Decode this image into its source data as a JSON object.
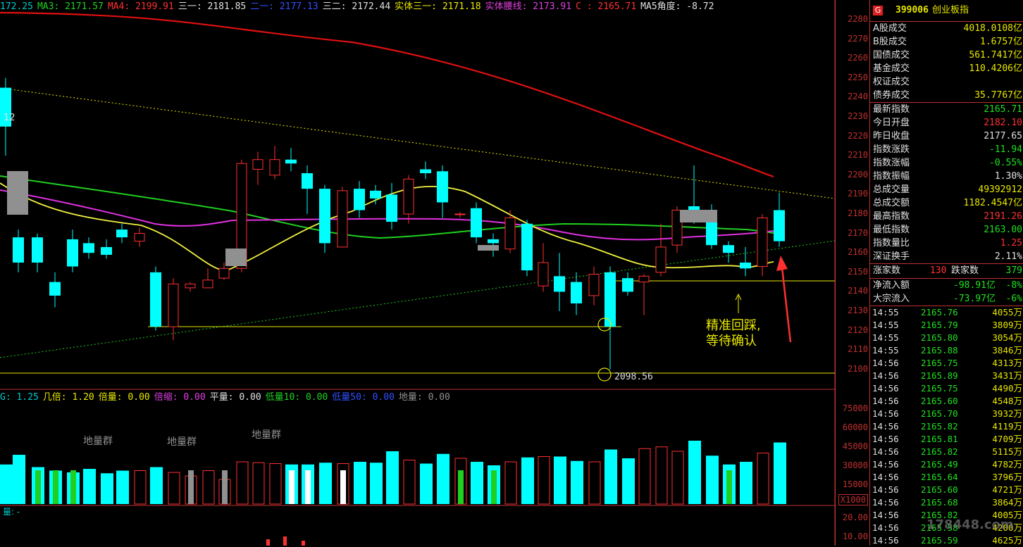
{
  "ma_bar": [
    {
      "text": "172.25",
      "color": "#00c8c8"
    },
    {
      "text": "MA3: 2171.57",
      "color": "#20d020"
    },
    {
      "text": "MA4: 2199.91",
      "color": "#ff3030"
    },
    {
      "text": "三一: 2181.85",
      "color": "#e0e0e0"
    },
    {
      "text": "二一: 2177.13",
      "color": "#3050ff"
    },
    {
      "text": "三二: 2172.44",
      "color": "#e0e0e0"
    },
    {
      "text": "实体三一: 2171.18",
      "color": "#e8e800"
    },
    {
      "text": "实体腰线: 2173.91",
      "color": "#e040e0"
    },
    {
      "text": "C : 2165.71",
      "color": "#ff3030"
    },
    {
      "text": "MA5角度: -8.72",
      "color": "#e0e0e0"
    }
  ],
  "vol_bar": [
    {
      "text": "G: 1.25",
      "color": "#00c8c8"
    },
    {
      "text": "几倍: 1.20",
      "color": "#e8e800"
    },
    {
      "text": "倍量: 0.00",
      "color": "#e8e800"
    },
    {
      "text": "倍缩: 0.00",
      "color": "#e040e0"
    },
    {
      "text": "平量: 0.00",
      "color": "#e0e0e0"
    },
    {
      "text": "低量10: 0.00",
      "color": "#20d020"
    },
    {
      "text": "低量50: 0.00",
      "color": "#3050ff"
    },
    {
      "text": "地量: 0.00",
      "color": "#909090"
    }
  ],
  "price_axis": [
    "2280",
    "2270",
    "2260",
    "2250",
    "2240",
    "2230",
    "2220",
    "2210",
    "2200",
    "2190",
    "2180",
    "2170",
    "2160",
    "2150",
    "2140",
    "2130",
    "2120",
    "2110",
    "2100"
  ],
  "vol_axis": [
    "75000",
    "60000",
    "45000",
    "30000",
    "15000",
    "X1000"
  ],
  "low_axis": [
    "20.00",
    "10.00"
  ],
  "labels": {
    "low_point": "2098.56",
    "left_num": "12",
    "ground_vol_1": "地量群",
    "ground_vol_2": "地量群",
    "ground_vol_3": "地量群",
    "note_line1": "精准回踩,",
    "note_line2": "等待确认",
    "watermark": "178448.com"
  },
  "header": {
    "badge": "G",
    "code": "399006",
    "name": "创业板指"
  },
  "stats_a": [
    {
      "label": "A股成交",
      "value": "4018.0108亿",
      "color": "yellow"
    },
    {
      "label": "B股成交",
      "value": "1.6757亿",
      "color": "yellow"
    },
    {
      "label": "国债成交",
      "value": "561.7417亿",
      "color": "yellow"
    },
    {
      "label": "基金成交",
      "value": "110.4206亿",
      "color": "yellow"
    },
    {
      "label": "权证成交",
      "value": "",
      "color": "yellow"
    },
    {
      "label": "债券成交",
      "value": "35.7767亿",
      "color": "yellow"
    }
  ],
  "stats_b": [
    {
      "label": "最新指数",
      "value": "2165.71",
      "color": "green"
    },
    {
      "label": "今日开盘",
      "value": "2182.10",
      "color": "red"
    },
    {
      "label": "昨日收盘",
      "value": "2177.65",
      "color": "white"
    },
    {
      "label": "指数涨跌",
      "value": "-11.94",
      "color": "green"
    },
    {
      "label": "指数涨幅",
      "value": "-0.55%",
      "color": "green"
    },
    {
      "label": "指数振幅",
      "value": "1.30%",
      "color": "white"
    },
    {
      "label": "总成交量",
      "value": "49392912",
      "color": "yellow"
    },
    {
      "label": "总成交额",
      "value": "1182.4547亿",
      "color": "yellow"
    },
    {
      "label": "最高指数",
      "value": "2191.26",
      "color": "red"
    },
    {
      "label": "最低指数",
      "value": "2163.00",
      "color": "green"
    },
    {
      "label": "指数量比",
      "value": "1.25",
      "color": "red"
    },
    {
      "label": "深证换手",
      "value": "2.11%",
      "color": "white"
    }
  ],
  "breadth": {
    "up_label": "涨家数",
    "up": "130",
    "down_label": "跌家数",
    "down": "379"
  },
  "flows": [
    {
      "label": "净流入额",
      "value": "-98.91亿",
      "pct": "-8%"
    },
    {
      "label": "大宗流入",
      "value": "-73.97亿",
      "pct": "-6%"
    }
  ],
  "ticks": [
    {
      "time": "14:55",
      "price": "2165.76",
      "vol": "4055万"
    },
    {
      "time": "14:55",
      "price": "2165.79",
      "vol": "3809万"
    },
    {
      "time": "14:55",
      "price": "2165.80",
      "vol": "3054万"
    },
    {
      "time": "14:55",
      "price": "2165.88",
      "vol": "3846万"
    },
    {
      "time": "14:56",
      "price": "2165.75",
      "vol": "4313万"
    },
    {
      "time": "14:56",
      "price": "2165.89",
      "vol": "3431万"
    },
    {
      "time": "14:56",
      "price": "2165.75",
      "vol": "4490万"
    },
    {
      "time": "14:56",
      "price": "2165.60",
      "vol": "4548万"
    },
    {
      "time": "14:56",
      "price": "2165.70",
      "vol": "3932万"
    },
    {
      "time": "14:56",
      "price": "2165.82",
      "vol": "4119万"
    },
    {
      "time": "14:56",
      "price": "2165.81",
      "vol": "4709万"
    },
    {
      "time": "14:56",
      "price": "2165.82",
      "vol": "5115万"
    },
    {
      "time": "14:56",
      "price": "2165.49",
      "vol": "4782万"
    },
    {
      "time": "14:56",
      "price": "2165.64",
      "vol": "3796万"
    },
    {
      "time": "14:56",
      "price": "2165.60",
      "vol": "4721万"
    },
    {
      "time": "14:56",
      "price": "2165.68",
      "vol": "3864万"
    },
    {
      "time": "14:56",
      "price": "2165.82",
      "vol": "4005万"
    },
    {
      "time": "14:56",
      "price": "2165.58",
      "vol": "4200万"
    },
    {
      "time": "14:56",
      "price": "2165.59",
      "vol": "4625万"
    }
  ],
  "colors": {
    "up": "#ff3030",
    "down": "#00ffff",
    "ma_red": "#e01010",
    "ma_green": "#20d020",
    "ma_magenta": "#e030e0",
    "ma_yellow": "#f0f040",
    "grid": "#c03030"
  }
}
